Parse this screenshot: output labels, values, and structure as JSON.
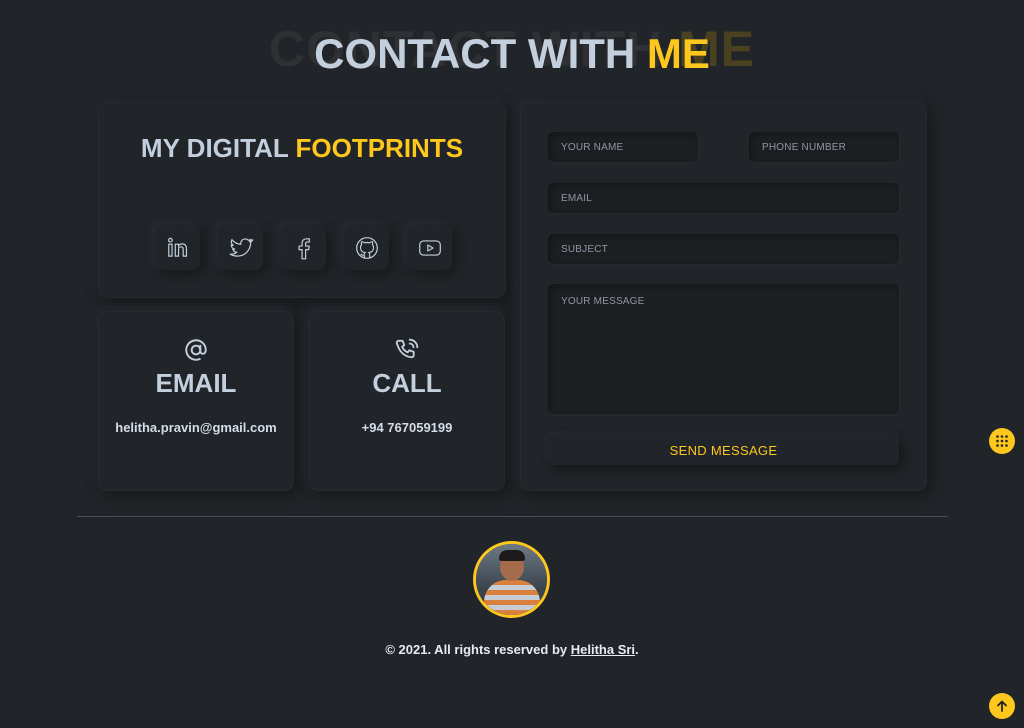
{
  "heading": {
    "shadow_prefix": "CONTACT WITH ",
    "shadow_highlight": "ME",
    "prefix": "CONTACT WITH ",
    "highlight": "ME"
  },
  "footprints": {
    "title_prefix": "MY DIGITAL ",
    "title_highlight": "FOOTPRINTS",
    "socials": [
      "linkedin-icon",
      "twitter-icon",
      "facebook-icon",
      "github-icon",
      "youtube-icon"
    ]
  },
  "email_card": {
    "icon": "at-sign-icon",
    "title": "EMAIL",
    "value": "helitha.pravin@gmail.com"
  },
  "call_card": {
    "icon": "phone-icon",
    "title": "CALL",
    "value": "+94 767059199"
  },
  "form": {
    "name_placeholder": "YOUR NAME",
    "phone_placeholder": "PHONE NUMBER",
    "email_placeholder": "EMAIL",
    "subject_placeholder": "SUBJECT",
    "message_placeholder": "YOUR MESSAGE",
    "send_label": "SEND MESSAGE"
  },
  "footer": {
    "copyright_prefix": "© 2021. All rights reserved by ",
    "author_link": "Helitha Sri",
    "copyright_suffix": "."
  },
  "colors": {
    "background": "#212428",
    "accent": "#fdc71e",
    "text": "#c4cfde"
  },
  "fabs": {
    "menu_icon": "grid-dots-icon",
    "top_icon": "arrow-up-icon"
  }
}
